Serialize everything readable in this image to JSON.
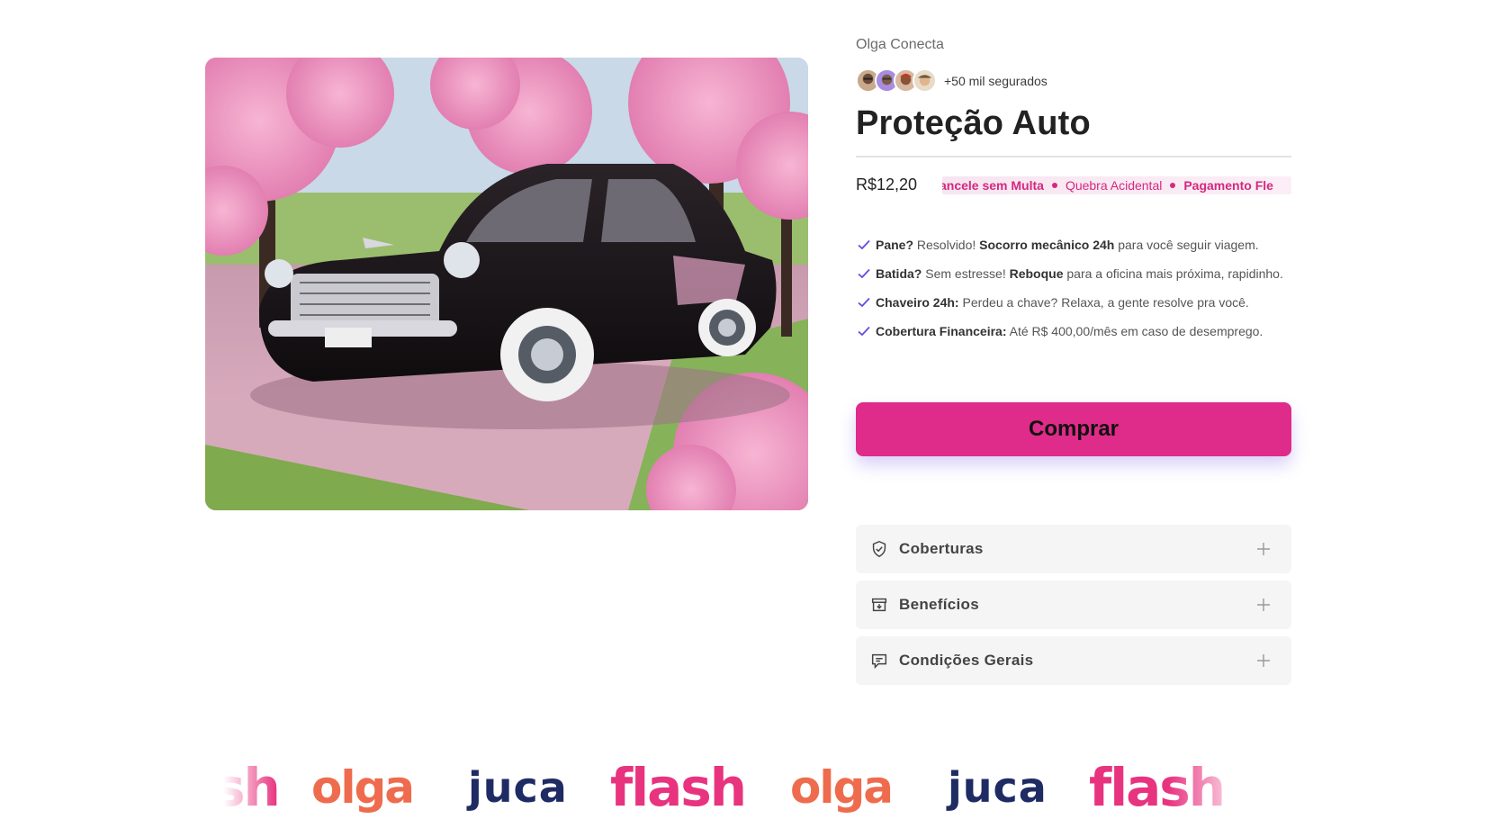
{
  "product": {
    "image_alt": "",
    "brand": "Olga Conecta",
    "social_proof": "+50 mil segurados",
    "title": "Proteção Auto",
    "price": "R$12,20"
  },
  "ticker": [
    {
      "label": "ancele sem Multa",
      "bold": true
    },
    {
      "label": "Quebra Acidental",
      "bold": false
    },
    {
      "label": "Pagamento Fle",
      "bold": true
    }
  ],
  "features": [
    {
      "lead": "Pane?",
      "text1": " Resolvido! ",
      "bold2": "Socorro mecânico 24h",
      "text2": " para você seguir viagem."
    },
    {
      "lead": "Batida?",
      "text1": " Sem estresse! ",
      "bold2": "Reboque",
      "text2": " para a oficina mais próxima, rapidinho."
    },
    {
      "lead": "Chaveiro 24h:",
      "text1": " Perdeu a chave? Relaxa, a gente resolve pra você.",
      "bold2": "",
      "text2": ""
    },
    {
      "lead": "Cobertura Financeira:",
      "text1": " Até R$ 400,00/mês em caso de desemprego.",
      "bold2": "",
      "text2": ""
    }
  ],
  "buy_button": {
    "label": "Comprar"
  },
  "accordions": [
    {
      "label": "Coberturas",
      "icon": "shield-check-icon"
    },
    {
      "label": "Benefícios",
      "icon": "archive-icon"
    },
    {
      "label": "Condições Gerais",
      "icon": "chat-icon"
    }
  ],
  "logos": [
    "sh",
    "olga",
    "juca",
    "flash",
    "olga",
    "juca",
    "flash"
  ],
  "colors": {
    "accent": "#df2b89",
    "check": "#5b4fe0",
    "olga": "#ee6c4d",
    "juca": "#1f2b63",
    "flash": "#e8337f"
  }
}
